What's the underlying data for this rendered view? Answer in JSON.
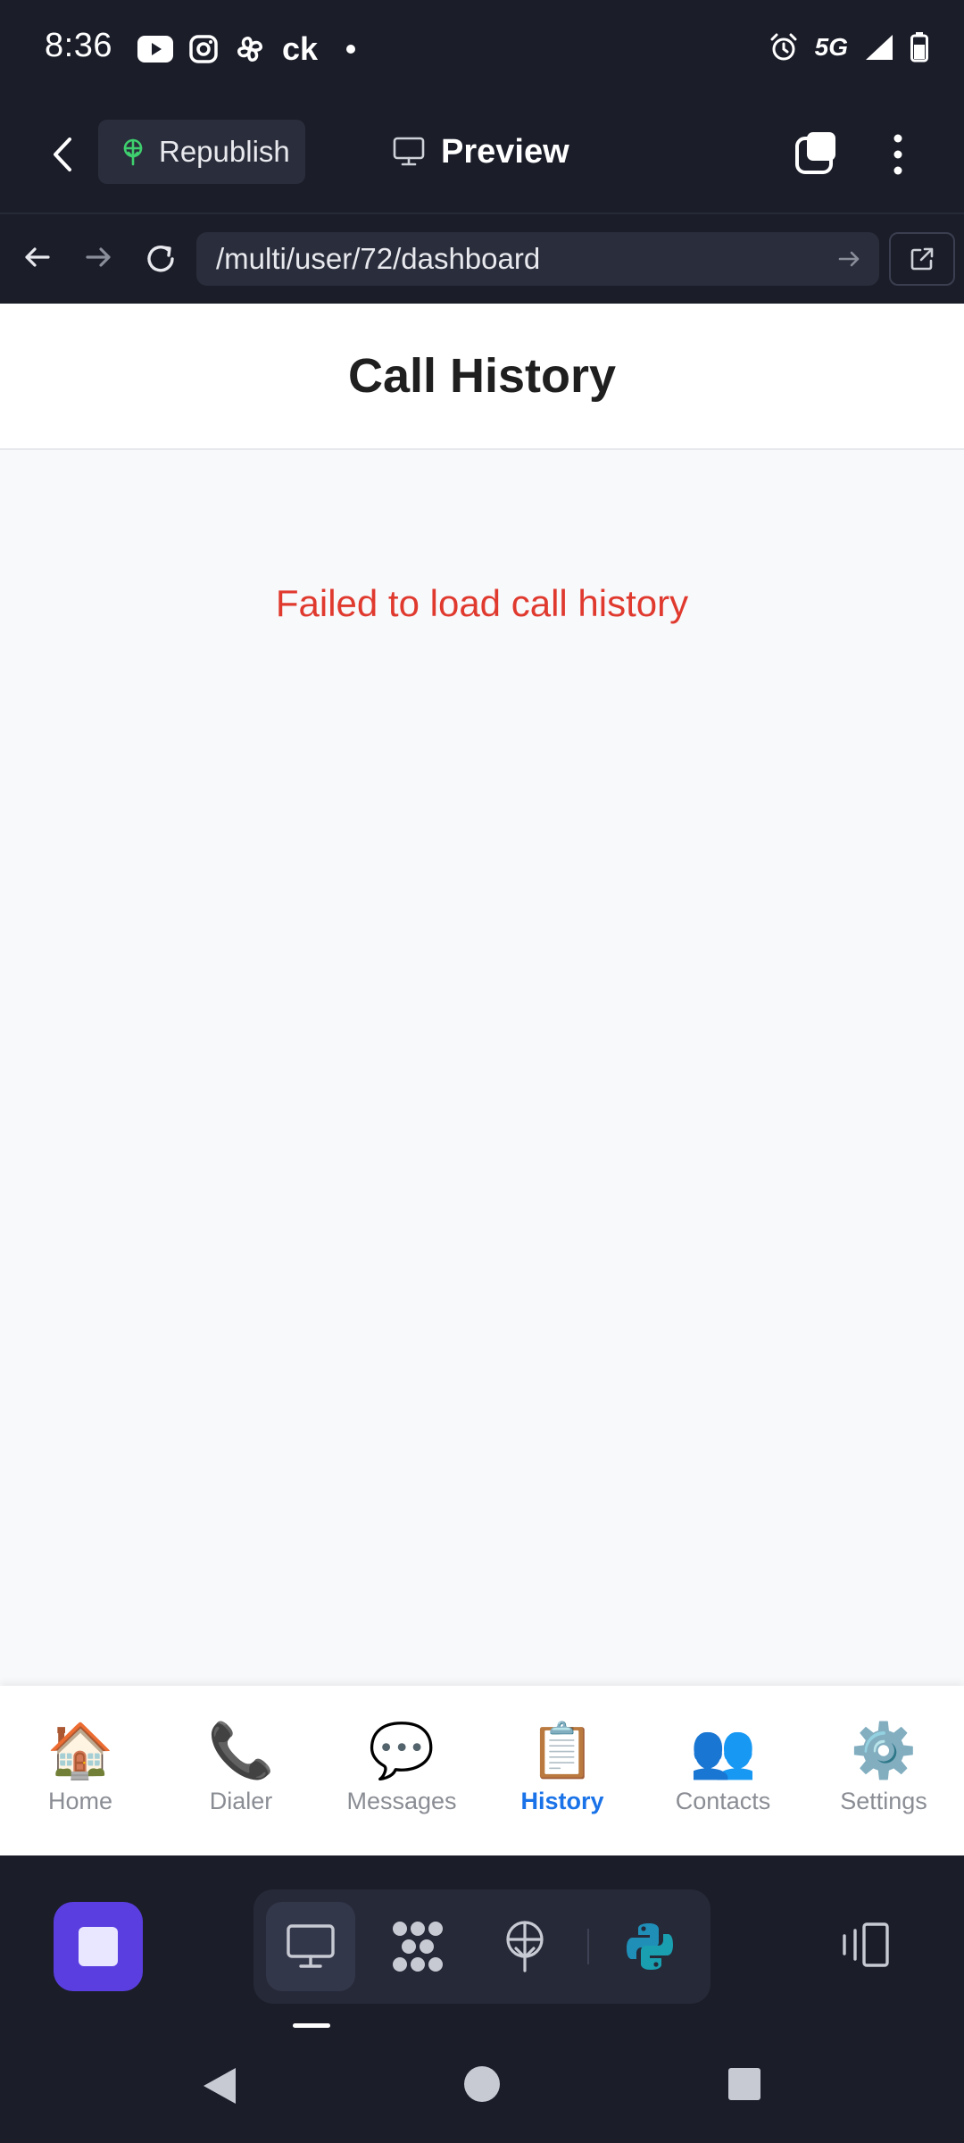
{
  "status_bar": {
    "time": "8:36",
    "carrier_text": "ck",
    "network": "5G",
    "icons": [
      "youtube-icon",
      "instagram-icon",
      "pinwheel-icon",
      "alarm-icon",
      "signal-icon",
      "battery-icon"
    ]
  },
  "toolbar": {
    "republish_label": "Republish",
    "preview_label": "Preview"
  },
  "browser": {
    "url": "/multi/user/72/dashboard"
  },
  "page": {
    "title": "Call History",
    "error_message": "Failed to load call history"
  },
  "bottom_nav": {
    "items": [
      {
        "label": "Home",
        "icon": "🏠",
        "active": false
      },
      {
        "label": "Dialer",
        "icon": "📞",
        "active": false
      },
      {
        "label": "Messages",
        "icon": "💬",
        "active": false
      },
      {
        "label": "History",
        "icon": "📋",
        "active": true
      },
      {
        "label": "Contacts",
        "icon": "👥",
        "active": false
      },
      {
        "label": "Settings",
        "icon": "⚙️",
        "active": false
      }
    ]
  },
  "colors": {
    "chrome_bg": "#1b1d29",
    "accent_active": "#1a73e8",
    "error": "#e03a2f",
    "dock_stop": "#5a3ee0"
  }
}
